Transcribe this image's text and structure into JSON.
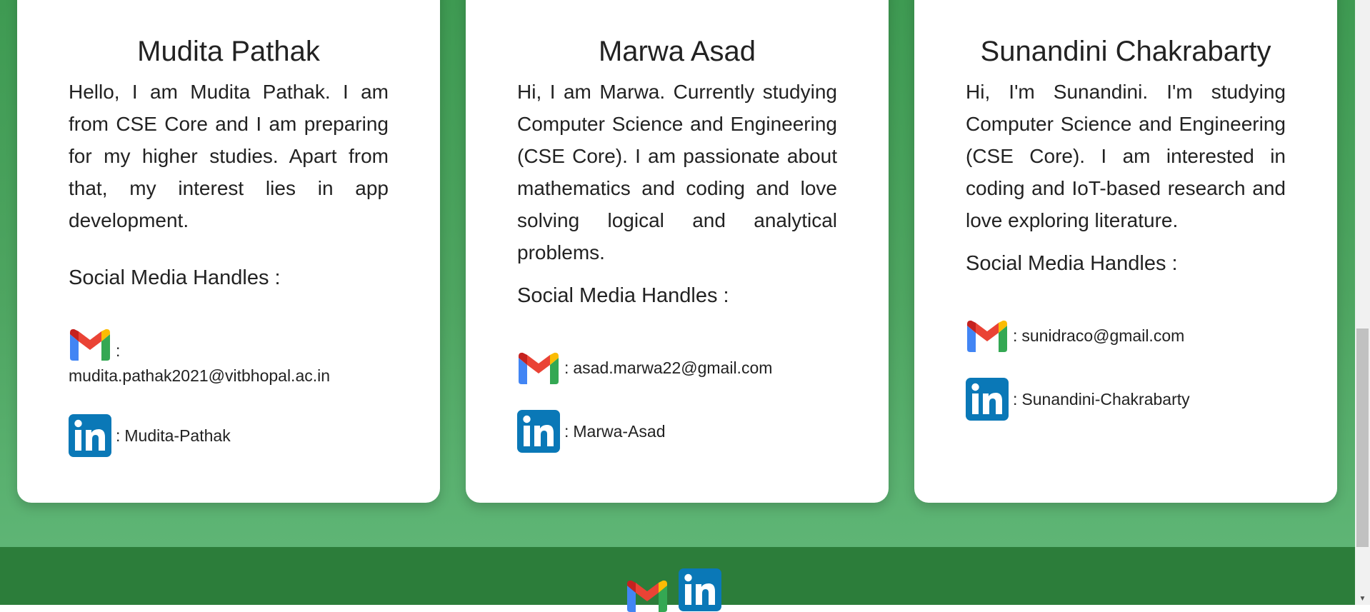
{
  "members": [
    {
      "name": "Mudita Pathak",
      "bio": "Hello, I am Mudita Pathak. I am from CSE Core and I am preparing for my higher studies. Apart from that, my interest lies in app development.",
      "social_title": "Social Media Handles :",
      "email_sep": ":",
      "email": "mudita.pathak2021@vitbhopal.ac.in",
      "linkedin_sep": ":",
      "linkedin": "Mudita-Pathak"
    },
    {
      "name": "Marwa Asad",
      "bio": "Hi, I am Marwa. Currently studying Computer Science and Engineering (CSE Core). I am passionate about mathematics and coding and love solving logical and analytical problems.",
      "social_title": "Social Media Handles :",
      "email_sep": ":",
      "email": "asad.marwa22@gmail.com",
      "linkedin_sep": ":",
      "linkedin": "Marwa-Asad"
    },
    {
      "name": "Sunandini Chakrabarty",
      "bio": "Hi, I'm Sunandini. I'm studying Computer Science and Engineering (CSE Core). I am interested in coding and IoT-based research and love exploring literature.",
      "social_title": "Social Media Handles :",
      "email_sep": ":",
      "email": "sunidraco@gmail.com",
      "linkedin_sep": ":",
      "linkedin": "Sunandini-Chakrabarty"
    }
  ],
  "icons": {
    "email": "gmail-icon",
    "linkedin": "linkedin-icon"
  },
  "colors": {
    "page_bg_top": "#3e9a52",
    "page_bg_bottom": "#62b97a",
    "footer_bg": "#2c7d3a",
    "card_bg": "#ffffff",
    "linkedin_blue": "#0a78b7"
  }
}
